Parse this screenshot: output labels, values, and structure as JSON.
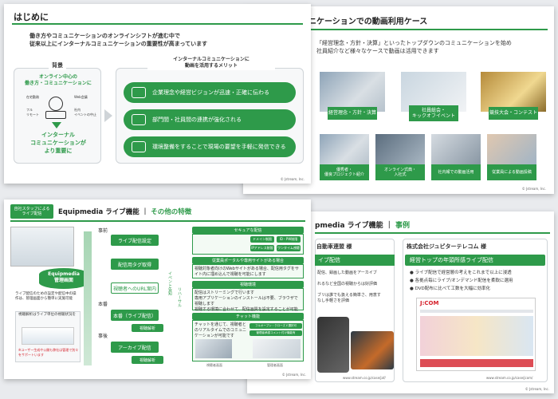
{
  "slide1": {
    "title": "はじめに",
    "lead": "働き方やコミュニケーションのオンラインシフトが進む中で\n従来以上にインターナルコミュニケーションの重要性が高まっています",
    "left_label": "背景",
    "left_top": "オンライン中心の\n働き方・コミュニケーションに",
    "left_items": [
      "在宅勤務",
      "Web会議",
      "フル\nリモート",
      "社内\nイベントの中止"
    ],
    "left_bottom": "インターナル\nコミュニケーションが\nより重要に",
    "right_label": "インターナルコミュニケーションに\n動画を活用するメリット",
    "merits": [
      "企業理念や経営ビジョンが迅速・正確に伝わる",
      "部門間・社員間の連携が強化される",
      "環境整備をすることで現場の要望を手軽に発信できる"
    ],
    "footer": "© Jstream, Inc."
  },
  "slide2": {
    "title": "ミュニケーションでの動画利用ケース",
    "lead": "「経営理念・方針・決算」といったトップダウンのコミュニケーションを始め\n社員紹介など様々なケースで動画は活用できます",
    "cases_top": [
      "経営理念・方針・決算",
      "社員総会・\nキックオフイベント",
      "競技大会・コンテスト"
    ],
    "cases_bottom": [
      "優秀者・\n優良プロジェクト紹介",
      "オンライン式典・\n入社式",
      "社内報での動画活用",
      "従業員による動画投稿"
    ],
    "footer": "© Jstream, Inc."
  },
  "slide3": {
    "tag": "自社スタッフによる\nライブ配信",
    "title_a": "Equipmedia ライブ機能 ｜",
    "title_b": "その他の特徴",
    "server": "Equipmedia\n管理画面",
    "note_a": "ライブ配信のための設定や配信中の操作は、管理画面から簡単に実施可能",
    "note_b": "視聴解析はライブ単位の視聴状況を",
    "note_c": "※ユーザー生成や公開も弊社は管理で別々をサポートいます",
    "phases": [
      "事前",
      "本番",
      "事後"
    ],
    "steps": [
      "ライブ配信設定",
      "配信用タグ取得",
      "視聴者へのURL案内",
      "本番（ライブ配信）",
      "視聴解析",
      "アーカイブ配信",
      "視聴解析"
    ],
    "arrow_a": "イベント告知",
    "arrow_b": "リハーサル",
    "boxes": [
      {
        "title": "セキュアな配信",
        "items": [
          "ドメイン制限",
          "ID・PW制限",
          "IPアドレス制限",
          "ワンタイム視聴"
        ]
      },
      {
        "title": "従業員ポータルや専用サイトがある場合",
        "items": [
          "視聴対象者向けのWebサイトがある場合、配信用タグをサイト内に埋め込んで視聴を可能にします"
        ]
      },
      {
        "title": "視聴環境",
        "items": [
          "配信はストリーミングで行います",
          "専用アプリケーションのインストールは不要、ブラウザで視聴します",
          "視聴する環境に合わせて、配信画質を設定することが可能です"
        ]
      },
      {
        "title": "チャット機能",
        "items": [
          "チャットを通じて、視聴者とのリアルタイムでのコミュニケーションが可能です"
        ]
      }
    ],
    "chat_tags": [
      "フルオープン・クローズド選択可",
      "管理者承認コメント付け機能有"
    ],
    "shot_labels": [
      "視聴者画面",
      "管理者画面"
    ],
    "footer": "© Jstream, Inc."
  },
  "slide4": {
    "title_a": "pmedia ライブ機能 ｜",
    "title_b": "事例",
    "left_company": "自動車連盟 様",
    "left_heading": "イブ配信",
    "left_text": "配信、録画した動画をアーカイブ\n\nれるなど全国の視聴からは好評価\n\nブリは誰でも扱える簡単さ、用意す\nなし手軽さを評価",
    "right_company": "株式会社ジュピターテレコム 様",
    "right_heading": "経営トップの年頭所感ライブ配信",
    "right_bullets": [
      "ライブ配信で経営層の考えをこれまで以上に浸透",
      "各拠点毎にライブ/オンデマンド配信を柔軟に選用",
      "DVD配布に比べて工数を大幅に効率化"
    ],
    "left_url": "www.stream.co.jp/case/jaf/",
    "right_url": "www.stream.co.jp/case/jcom/",
    "logo": "J:COM",
    "footer": "© Jstream, Inc."
  }
}
